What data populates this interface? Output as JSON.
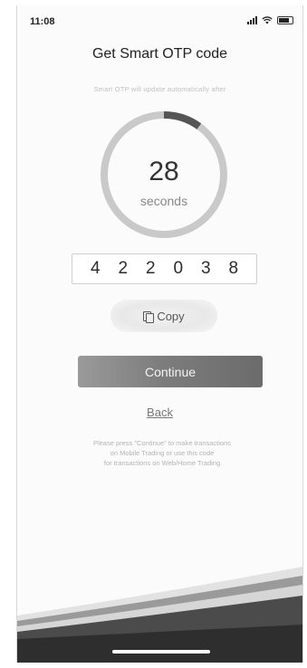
{
  "status_bar": {
    "time": "11:08",
    "signal_icon": "cell-signal-icon",
    "wifi_icon": "wifi-icon",
    "battery_icon": "battery-icon"
  },
  "screen": {
    "title": "Get Smart OTP code",
    "subtitle": "Smart OTP will update automatically after",
    "countdown": {
      "value": "28",
      "unit": "seconds",
      "progress_elapsed_fraction": 0.1
    },
    "otp_digits": [
      "4",
      "2",
      "2",
      "0",
      "3",
      "8"
    ],
    "copy_button": {
      "label": "Copy",
      "icon": "copy-icon"
    },
    "continue_button": {
      "label": "Continue"
    },
    "back_link": {
      "label": "Back"
    },
    "notice_lines": [
      "Please press \"Continue\" to make transactions",
      "on Mobile Trading or use this code",
      "for transactions on Web/Home Trading"
    ]
  },
  "colors": {
    "ring_track": "#c9c9c9",
    "ring_progress": "#555555",
    "button": "#7d7d7d"
  }
}
